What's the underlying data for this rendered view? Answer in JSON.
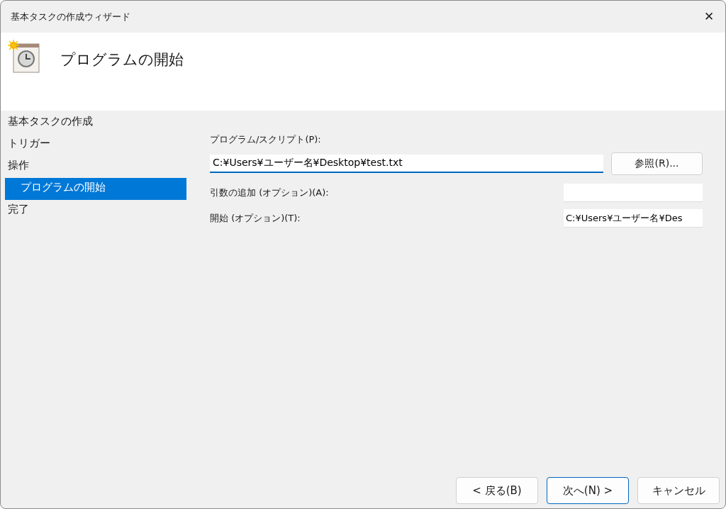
{
  "window": {
    "title": "基本タスクの作成ウィザード",
    "close": "✕"
  },
  "header": {
    "title": "プログラムの開始"
  },
  "steps": [
    {
      "label": "基本タスクの作成",
      "selected": false
    },
    {
      "label": "トリガー",
      "selected": false
    },
    {
      "label": "操作",
      "selected": false,
      "children": [
        {
          "label": "プログラムの開始",
          "selected": true
        }
      ]
    },
    {
      "label": "完了",
      "selected": false
    }
  ],
  "program": {
    "label": "プログラム/スクリプト(P):",
    "value": "C:¥Users¥ユーザー名¥Desktop¥test.txt",
    "focused": true,
    "browse": "参照(R)..."
  },
  "arguments": {
    "label": "引数の追加 (オプション)(A):"
  },
  "start_in": {
    "label": "開始 (オプション)(T):",
    "value": "C:¥Users¥ユーザー名¥Des"
  },
  "buttons": [
    {
      "label": "< 戻る(B)",
      "default": false
    },
    {
      "label": "次へ(N) >",
      "default": true
    },
    {
      "label": "キャンセル",
      "default": false
    }
  ]
}
